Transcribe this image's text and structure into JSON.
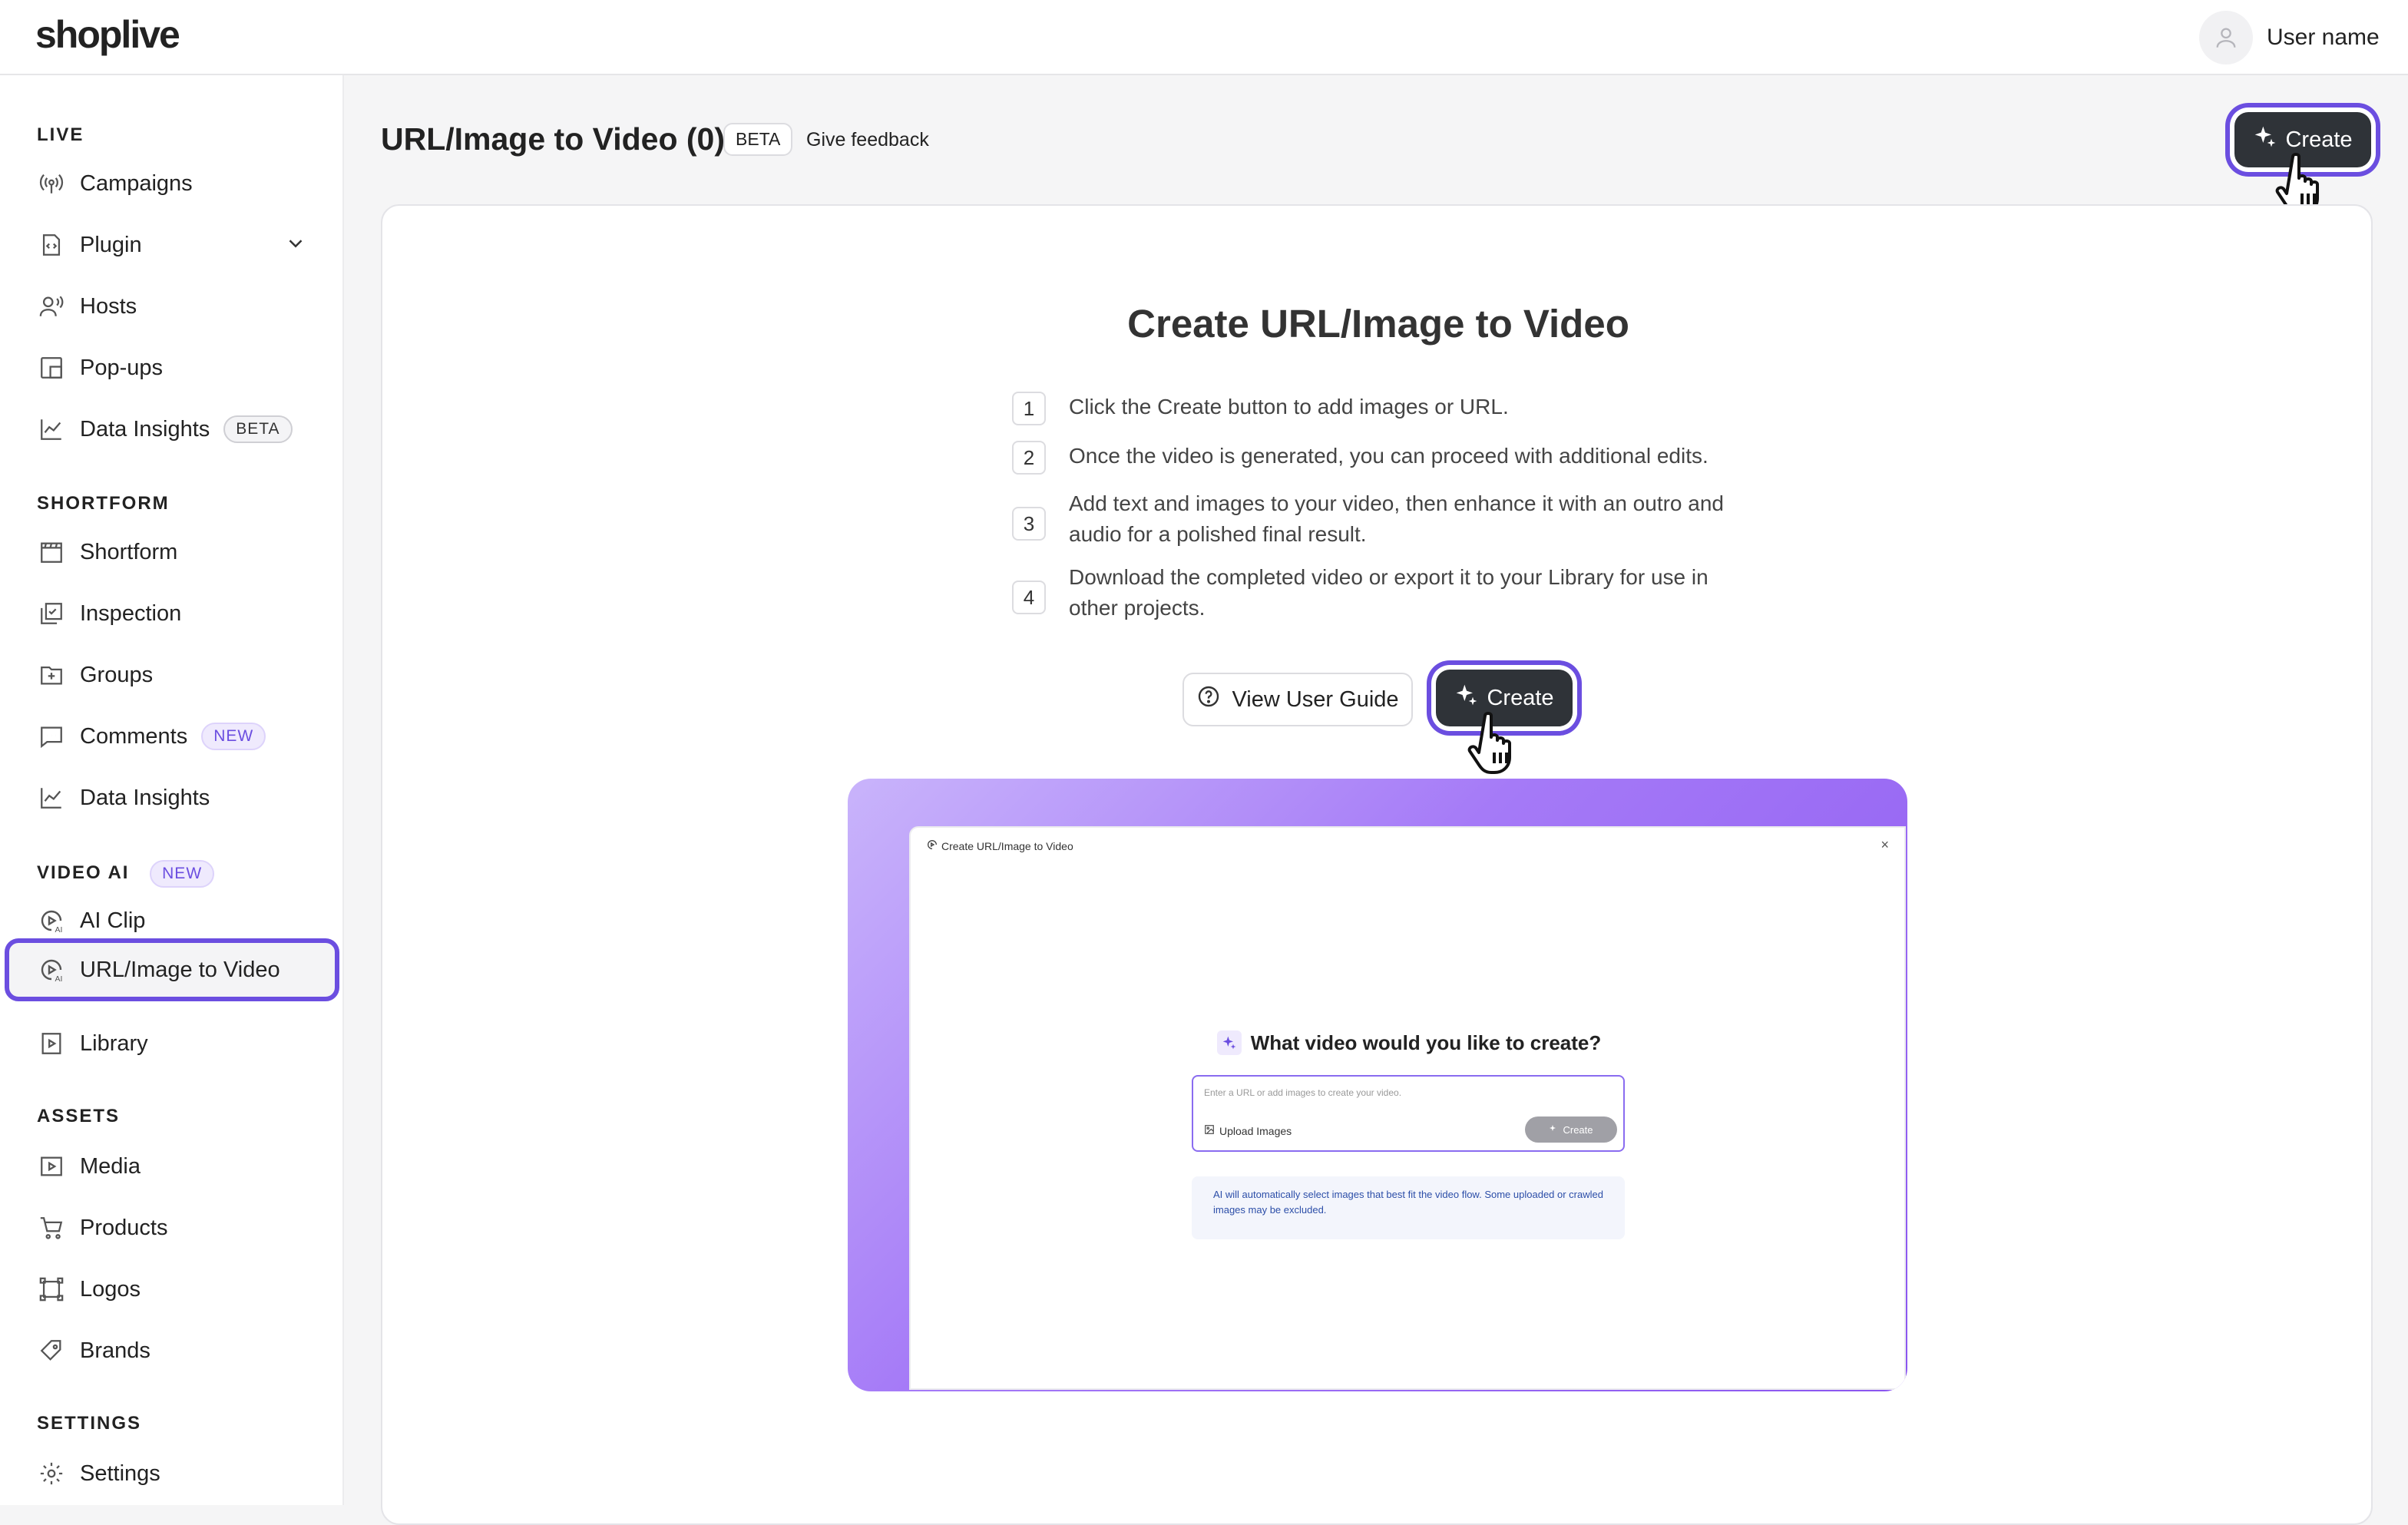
{
  "app": {
    "logo": "shoplive",
    "user_name": "User name"
  },
  "sidebar": {
    "sections": [
      {
        "title": "LIVE",
        "items": [
          {
            "label": "Campaigns",
            "icon": "broadcast-icon"
          },
          {
            "label": "Plugin",
            "icon": "plugin-icon",
            "expandable": true
          },
          {
            "label": "Hosts",
            "icon": "host-icon"
          },
          {
            "label": "Pop-ups",
            "icon": "popup-icon"
          },
          {
            "label": "Data Insights",
            "icon": "chart-icon",
            "badge": "BETA"
          }
        ]
      },
      {
        "title": "SHORTFORM",
        "items": [
          {
            "label": "Shortform",
            "icon": "clapper-icon"
          },
          {
            "label": "Inspection",
            "icon": "inspection-icon"
          },
          {
            "label": "Groups",
            "icon": "folder-plus-icon"
          },
          {
            "label": "Comments",
            "icon": "comment-icon",
            "badge": "NEW"
          },
          {
            "label": "Data Insights",
            "icon": "chart-icon"
          }
        ]
      },
      {
        "title": "VIDEO AI",
        "title_badge": "NEW",
        "items": [
          {
            "label": "AI Clip",
            "icon": "ai-play-icon"
          },
          {
            "label": "URL/Image to Video",
            "icon": "ai-play-icon",
            "active": true
          },
          {
            "label": "Library",
            "icon": "library-icon"
          }
        ]
      },
      {
        "title": "ASSETS",
        "items": [
          {
            "label": "Media",
            "icon": "media-icon"
          },
          {
            "label": "Products",
            "icon": "cart-icon"
          },
          {
            "label": "Logos",
            "icon": "logo-frame-icon"
          },
          {
            "label": "Brands",
            "icon": "tag-icon"
          }
        ]
      },
      {
        "title": "SETTINGS",
        "items": [
          {
            "label": "Settings",
            "icon": "gear-icon"
          }
        ]
      }
    ]
  },
  "main": {
    "title": "URL/Image to Video (0)",
    "title_badge": "BETA",
    "feedback_label": "Give feedback",
    "create_label": "Create",
    "card": {
      "title": "Create URL/Image to Video",
      "steps": [
        {
          "num": "1",
          "text": "Click the Create button to add images or URL."
        },
        {
          "num": "2",
          "text": "Once the video is generated, you can proceed with additional edits."
        },
        {
          "num": "3",
          "text": "Add text and images to your video, then enhance it with an outro and audio for a polished final result."
        },
        {
          "num": "4",
          "text": "Download the completed video or export it to your Library for use in other projects."
        }
      ],
      "guide_label": "View User Guide",
      "create_label": "Create"
    },
    "preview": {
      "window_title": "Create URL/Image to Video",
      "close": "×",
      "question": "What video would you like to create?",
      "input_placeholder": "Enter a URL or add images to create your video.",
      "upload_label": "Upload Images",
      "create_label": "Create",
      "note": "AI will automatically select images that best fit the video flow. Some uploaded or crawled images may be excluded."
    }
  },
  "colors": {
    "accent": "#6b4ee0",
    "button_dark": "#2f3338",
    "preview_gradient_start": "#c9b4fb",
    "preview_gradient_end": "#8a55f0"
  }
}
